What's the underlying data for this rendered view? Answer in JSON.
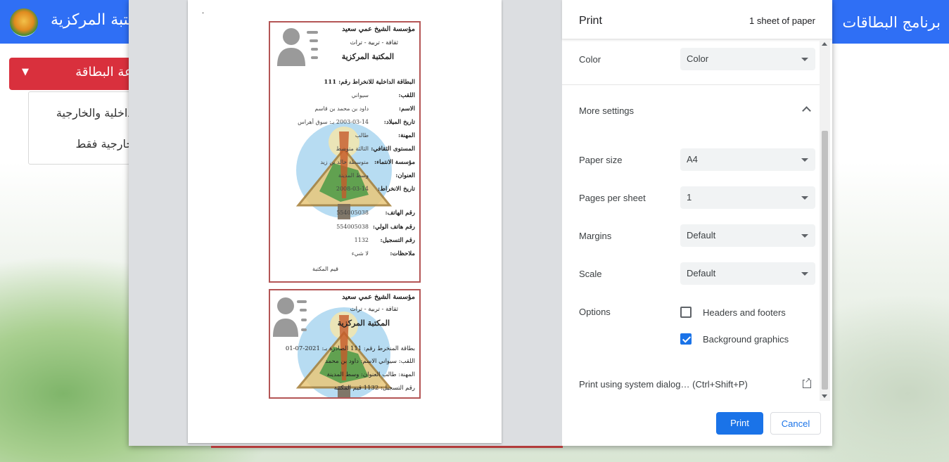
{
  "app": {
    "title": "المكتبة المركزية",
    "brand": "برنامج البطاقات",
    "print_card_button": "طباعة البطاقة",
    "menu_items": [
      "الداخلية والخارجية",
      "الخارجية فقط"
    ]
  },
  "preview": {
    "card1": {
      "org": "مؤسسة الشيخ عمي سعيد",
      "tagline": "ثقافة - تربية - تراث",
      "library": "المكتبة المركزية",
      "header": "البطاقة الداخلية للانخراط رقم: 111",
      "rows": [
        {
          "label": "اللقب:",
          "value": "سيواني"
        },
        {
          "label": "الاسم:",
          "value": "داود بن محمد بن قاسم"
        },
        {
          "label": "تاريخ الميلاد:",
          "value": "2003-03-14 بـ: سوق أهراس"
        },
        {
          "label": "المهنة:",
          "value": "طالب"
        },
        {
          "label": "المستوى الثقافي:",
          "value": "الثالثة متوسط"
        },
        {
          "label": "مؤسسة الانتماء:",
          "value": "متوسطة خالد بن زيد"
        },
        {
          "label": "العنوان:",
          "value": "وسط المدينة"
        },
        {
          "label": "تاريخ الانخراط:",
          "value": "2008-03-14"
        },
        {
          "label": "رقم الهاتف:",
          "value": "554005038"
        },
        {
          "label": "رقم هاتف الولي:",
          "value": "554005038"
        },
        {
          "label": "رقم التسجيل:",
          "value": "1132"
        },
        {
          "label": "ملاحظات:",
          "value": "لا شيء"
        }
      ],
      "signature": "قيم المكتبة"
    },
    "card2": {
      "org": "مؤسسة الشيخ عمي سعيد",
      "tagline": "ثقافة - تربية - تراث",
      "library": "المكتبة المركزية",
      "line1": "بطاقة المنخرط رقم: 111   الصادرة بـ: 2021-07-01",
      "line2": "اللقب: سيواني   الاسم: داود بن محمد",
      "line3": "المهنة: طالب   العنوان: وسط المدينة",
      "line4": "رقم التسجيل: 1132   قيم المكتبة"
    },
    "colors": {
      "card_border": "#b45555"
    }
  },
  "print": {
    "title": "Print",
    "sheets": "1 sheet of paper",
    "color_label": "Color",
    "color_value": "Color",
    "more_settings": "More settings",
    "paper_size_label": "Paper size",
    "paper_size_value": "A4",
    "pages_per_sheet_label": "Pages per sheet",
    "pages_per_sheet_value": "1",
    "margins_label": "Margins",
    "margins_value": "Default",
    "scale_label": "Scale",
    "scale_value": "Default",
    "options_label": "Options",
    "headers_footers": "Headers and footers",
    "headers_footers_checked": false,
    "background_graphics": "Background graphics",
    "background_graphics_checked": true,
    "system_dialog": "Print using system dialog… (Ctrl+Shift+P)",
    "print_button": "Print",
    "cancel_button": "Cancel",
    "accent": "#1a73e8"
  }
}
